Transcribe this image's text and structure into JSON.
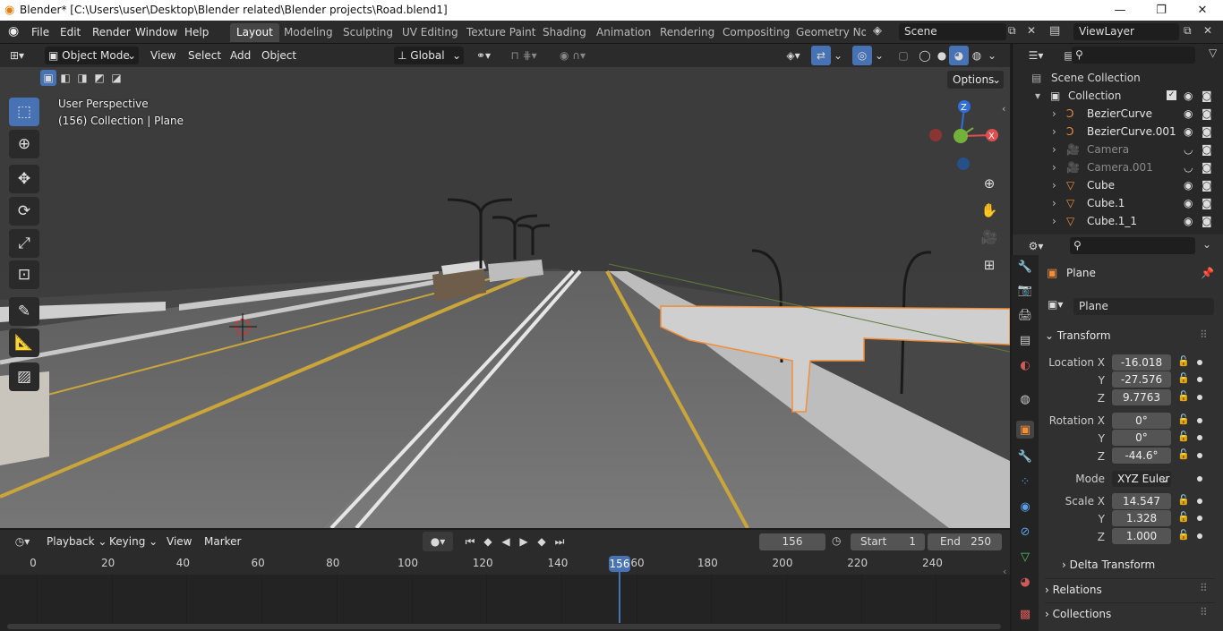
{
  "window": {
    "title": "Blender* [C:\\Users\\user\\Desktop\\Blender related\\Blender projects\\Road.blend1]",
    "minimize": "—",
    "maximize": "❐",
    "close": "✕"
  },
  "menus": [
    "File",
    "Edit",
    "Render",
    "Window",
    "Help"
  ],
  "workspaces": [
    "Layout",
    "Modeling",
    "Sculpting",
    "UV Editing",
    "Texture Paint",
    "Shading",
    "Animation",
    "Rendering",
    "Compositing",
    "Geometry Noc"
  ],
  "scene": "Scene",
  "view_layer": "ViewLayer",
  "viewport_header": {
    "mode": "Object Mode",
    "view": "View",
    "select": "Select",
    "add": "Add",
    "object": "Object",
    "orientation": "Global",
    "options": "Options"
  },
  "viewport": {
    "perspective": "User Perspective",
    "context": "(156) Collection | Plane"
  },
  "gizmo": {
    "z": "Z",
    "x": "X"
  },
  "outliner": {
    "root": "Scene Collection",
    "collection": "Collection",
    "items": [
      {
        "name": "BezierCurve",
        "icon": "curve-icon",
        "dim": false,
        "hidden": false
      },
      {
        "name": "BezierCurve.001",
        "icon": "curve-icon",
        "dim": false,
        "hidden": false
      },
      {
        "name": "Camera",
        "icon": "camera-icon",
        "dim": true,
        "hidden": true
      },
      {
        "name": "Camera.001",
        "icon": "camera-icon",
        "dim": true,
        "hidden": true
      },
      {
        "name": "Cube",
        "icon": "mesh-icon",
        "dim": false,
        "hidden": false
      },
      {
        "name": "Cube.1",
        "icon": "mesh-icon",
        "dim": false,
        "hidden": false
      },
      {
        "name": "Cube.1_1",
        "icon": "mesh-icon",
        "dim": false,
        "hidden": false
      }
    ]
  },
  "properties": {
    "object_name": "Plane",
    "data_name": "Plane",
    "transform_label": "Transform",
    "location": {
      "label": "Location X",
      "x": "-16.018",
      "y": "-27.576",
      "z": "9.7763"
    },
    "rotation": {
      "label": "Rotation X",
      "x": "0°",
      "y": "0°",
      "z": "-44.6°"
    },
    "mode_label": "Mode",
    "mode": "XYZ Euler",
    "scale": {
      "label": "Scale X",
      "x": "14.547",
      "y": "1.328",
      "z": "1.000"
    },
    "axis_y": "Y",
    "axis_z": "Z",
    "sections": [
      "Delta Transform",
      "Relations",
      "Collections"
    ]
  },
  "timeline": {
    "playback": "Playback",
    "keying": "Keying",
    "view": "View",
    "marker": "Marker",
    "current_frame": "156",
    "start_label": "Start",
    "start": "1",
    "end_label": "End",
    "end": "250",
    "ticks": [
      "0",
      "20",
      "40",
      "60",
      "80",
      "100",
      "120",
      "140",
      "60",
      "180",
      "200",
      "220",
      "240"
    ],
    "cursor_label": "156"
  },
  "colors": {
    "accent": "#4772b3",
    "selected_orange": "#f08e3a",
    "road_yellow": "#c9a53a"
  }
}
